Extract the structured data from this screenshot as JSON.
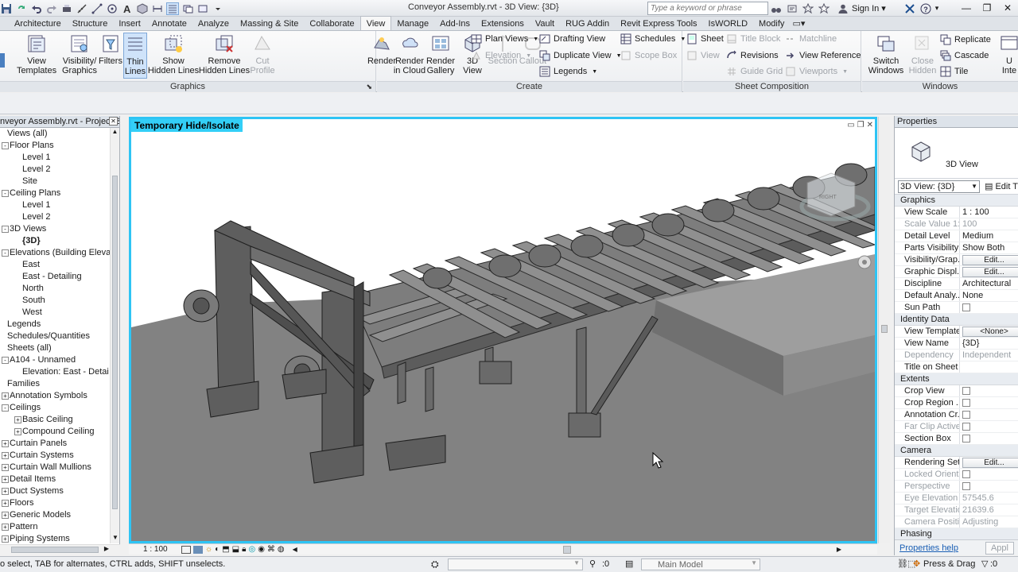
{
  "titlebar": {
    "document_title": "Conveyor Assembly.rvt - 3D View: {3D}",
    "search_placeholder": "Type a keyword or phrase",
    "sign_in": "Sign In"
  },
  "ribbon_tabs": [
    "Architecture",
    "Structure",
    "Insert",
    "Annotate",
    "Analyze",
    "Massing & Site",
    "Collaborate",
    "View",
    "Manage",
    "Add-Ins",
    "Extensions",
    "Vault",
    "RUG Addin",
    "Revit Express Tools",
    "IsWORLD",
    "Modify"
  ],
  "active_tab": "View",
  "ribbon": {
    "graphics": {
      "label": "Graphics",
      "view_templates": "View\nTemplates",
      "visibility_graphics": "Visibility/\nGraphics",
      "filters": "Filters",
      "thin_lines": "Thin\nLines",
      "show_hidden_lines": "Show\nHidden Lines",
      "remove_hidden_lines": "Remove\nHidden Lines",
      "cut_profile": "Cut\nProfile"
    },
    "create": {
      "label": "Create",
      "render": "Render",
      "render_in_cloud": "Render\nin Cloud",
      "render_gallery": "Render\nGallery",
      "view_3d": "3D\nView",
      "section": "Section",
      "callout": "Callout",
      "plan_views": "Plan Views",
      "elevation": "Elevation",
      "drafting_view": "Drafting View",
      "duplicate_view": "Duplicate View",
      "legends": "Legends",
      "schedules": "Schedules",
      "scope_box": "Scope Box"
    },
    "sheet_composition": {
      "label": "Sheet Composition",
      "sheet": "Sheet",
      "view": "View",
      "title_block": "Title Block",
      "revisions": "Revisions",
      "guide_grid": "Guide Grid",
      "matchline": "Matchline",
      "view_reference": "View Reference",
      "viewports": "Viewports"
    },
    "windows": {
      "label": "Windows",
      "switch_windows": "Switch\nWindows",
      "close_hidden": "Close\nHidden",
      "replicate": "Replicate",
      "cascade": "Cascade",
      "tile": "Tile",
      "user_interface": "U\nInte"
    }
  },
  "project_browser": {
    "title": "nveyor Assembly.rvt - Project Br...",
    "nodes": [
      {
        "label": "Views (all)",
        "level": 0,
        "exp": "-",
        "selected": false
      },
      {
        "label": "Floor Plans",
        "level": 1,
        "exp": "-",
        "selected": false
      },
      {
        "label": "Level 1",
        "level": 2,
        "exp": "",
        "selected": false
      },
      {
        "label": "Level 2",
        "level": 2,
        "exp": "",
        "selected": false
      },
      {
        "label": "Site",
        "level": 2,
        "exp": "",
        "selected": false
      },
      {
        "label": "Ceiling Plans",
        "level": 1,
        "exp": "-",
        "selected": false
      },
      {
        "label": "Level 1",
        "level": 2,
        "exp": "",
        "selected": false
      },
      {
        "label": "Level 2",
        "level": 2,
        "exp": "",
        "selected": false
      },
      {
        "label": "3D Views",
        "level": 1,
        "exp": "-",
        "selected": false
      },
      {
        "label": "{3D}",
        "level": 2,
        "exp": "",
        "selected": true
      },
      {
        "label": "Elevations (Building Elevatio",
        "level": 1,
        "exp": "-",
        "selected": false
      },
      {
        "label": "East",
        "level": 2,
        "exp": "",
        "selected": false
      },
      {
        "label": "East - Detailing",
        "level": 2,
        "exp": "",
        "selected": false
      },
      {
        "label": "North",
        "level": 2,
        "exp": "",
        "selected": false
      },
      {
        "label": "South",
        "level": 2,
        "exp": "",
        "selected": false
      },
      {
        "label": "West",
        "level": 2,
        "exp": "",
        "selected": false
      },
      {
        "label": "Legends",
        "level": 0,
        "exp": "",
        "selected": false
      },
      {
        "label": "Schedules/Quantities",
        "level": 0,
        "exp": "",
        "selected": false
      },
      {
        "label": "Sheets (all)",
        "level": 0,
        "exp": "-",
        "selected": false
      },
      {
        "label": "A104 - Unnamed",
        "level": 1,
        "exp": "-",
        "selected": false
      },
      {
        "label": "Elevation: East - Detai",
        "level": 2,
        "exp": "",
        "selected": false
      },
      {
        "label": "Families",
        "level": 0,
        "exp": "-",
        "selected": false
      },
      {
        "label": "Annotation Symbols",
        "level": 1,
        "exp": "+",
        "selected": false
      },
      {
        "label": "Ceilings",
        "level": 1,
        "exp": "-",
        "selected": false
      },
      {
        "label": "Basic Ceiling",
        "level": 2,
        "exp": "+",
        "selected": false
      },
      {
        "label": "Compound Ceiling",
        "level": 2,
        "exp": "+",
        "selected": false
      },
      {
        "label": "Curtain Panels",
        "level": 1,
        "exp": "+",
        "selected": false
      },
      {
        "label": "Curtain Systems",
        "level": 1,
        "exp": "+",
        "selected": false
      },
      {
        "label": "Curtain Wall Mullions",
        "level": 1,
        "exp": "+",
        "selected": false
      },
      {
        "label": "Detail Items",
        "level": 1,
        "exp": "+",
        "selected": false
      },
      {
        "label": "Duct Systems",
        "level": 1,
        "exp": "+",
        "selected": false
      },
      {
        "label": "Floors",
        "level": 1,
        "exp": "+",
        "selected": false
      },
      {
        "label": "Generic Models",
        "level": 1,
        "exp": "+",
        "selected": false
      },
      {
        "label": "Pattern",
        "level": 1,
        "exp": "+",
        "selected": false
      },
      {
        "label": "Piping Systems",
        "level": 1,
        "exp": "+",
        "selected": false
      }
    ]
  },
  "viewport": {
    "label": "Temporary Hide/Isolate",
    "scale": "1 : 100",
    "viewcube_text": "RIGHT"
  },
  "properties": {
    "title": "Properties",
    "type_name": "3D View",
    "selector": "3D View: {3D}",
    "edit_type": "Edit T",
    "groups": [
      {
        "name": "Graphics",
        "rows": [
          {
            "name": "View Scale",
            "value": "1 : 100",
            "kind": "text",
            "disabled": false
          },
          {
            "name": "Scale Value    1:",
            "value": "100",
            "kind": "text",
            "disabled": true
          },
          {
            "name": "Detail Level",
            "value": "Medium",
            "kind": "text",
            "disabled": false
          },
          {
            "name": "Parts Visibility",
            "value": "Show Both",
            "kind": "text",
            "disabled": false
          },
          {
            "name": "Visibility/Grap...",
            "value": "Edit...",
            "kind": "button",
            "disabled": false
          },
          {
            "name": "Graphic Displ...",
            "value": "Edit...",
            "kind": "button",
            "disabled": false
          },
          {
            "name": "Discipline",
            "value": "Architectural",
            "kind": "text",
            "disabled": false
          },
          {
            "name": "Default Analy...",
            "value": "None",
            "kind": "text",
            "disabled": false
          },
          {
            "name": "Sun Path",
            "value": "",
            "kind": "check",
            "disabled": false
          }
        ]
      },
      {
        "name": "Identity Data",
        "rows": [
          {
            "name": "View Template",
            "value": "<None>",
            "kind": "button",
            "disabled": false
          },
          {
            "name": "View Name",
            "value": "{3D}",
            "kind": "text",
            "disabled": false
          },
          {
            "name": "Dependency",
            "value": "Independent",
            "kind": "text",
            "disabled": true
          },
          {
            "name": "Title on Sheet",
            "value": "",
            "kind": "text",
            "disabled": false
          }
        ]
      },
      {
        "name": "Extents",
        "rows": [
          {
            "name": "Crop View",
            "value": "",
            "kind": "check",
            "disabled": false
          },
          {
            "name": "Crop Region ...",
            "value": "",
            "kind": "check",
            "disabled": false
          },
          {
            "name": "Annotation Cr...",
            "value": "",
            "kind": "check",
            "disabled": false
          },
          {
            "name": "Far Clip Active",
            "value": "",
            "kind": "check",
            "disabled": true
          },
          {
            "name": "Section Box",
            "value": "",
            "kind": "check",
            "disabled": false
          }
        ]
      },
      {
        "name": "Camera",
        "rows": [
          {
            "name": "Rendering Set...",
            "value": "Edit...",
            "kind": "button",
            "disabled": false
          },
          {
            "name": "Locked Orient...",
            "value": "",
            "kind": "check",
            "disabled": true
          },
          {
            "name": "Perspective",
            "value": "",
            "kind": "check",
            "disabled": true
          },
          {
            "name": "Eye Elevation",
            "value": "57545.6",
            "kind": "text",
            "disabled": true
          },
          {
            "name": "Target Elevation",
            "value": "21639.6",
            "kind": "text",
            "disabled": true
          },
          {
            "name": "Camera Positi...",
            "value": "Adjusting",
            "kind": "text",
            "disabled": true
          }
        ]
      },
      {
        "name": "Phasing",
        "rows": []
      }
    ],
    "help_link": "Properties help",
    "apply": "Appl"
  },
  "statusbar": {
    "message": "o select, TAB for alternates, CTRL adds, SHIFT unselects.",
    "zero1": ":0",
    "model": "Main Model",
    "press_drag": "Press & Drag",
    "zero2": ":0"
  },
  "colors": {
    "accent": "#2ec4f4",
    "label_bg": "#33cff7"
  }
}
